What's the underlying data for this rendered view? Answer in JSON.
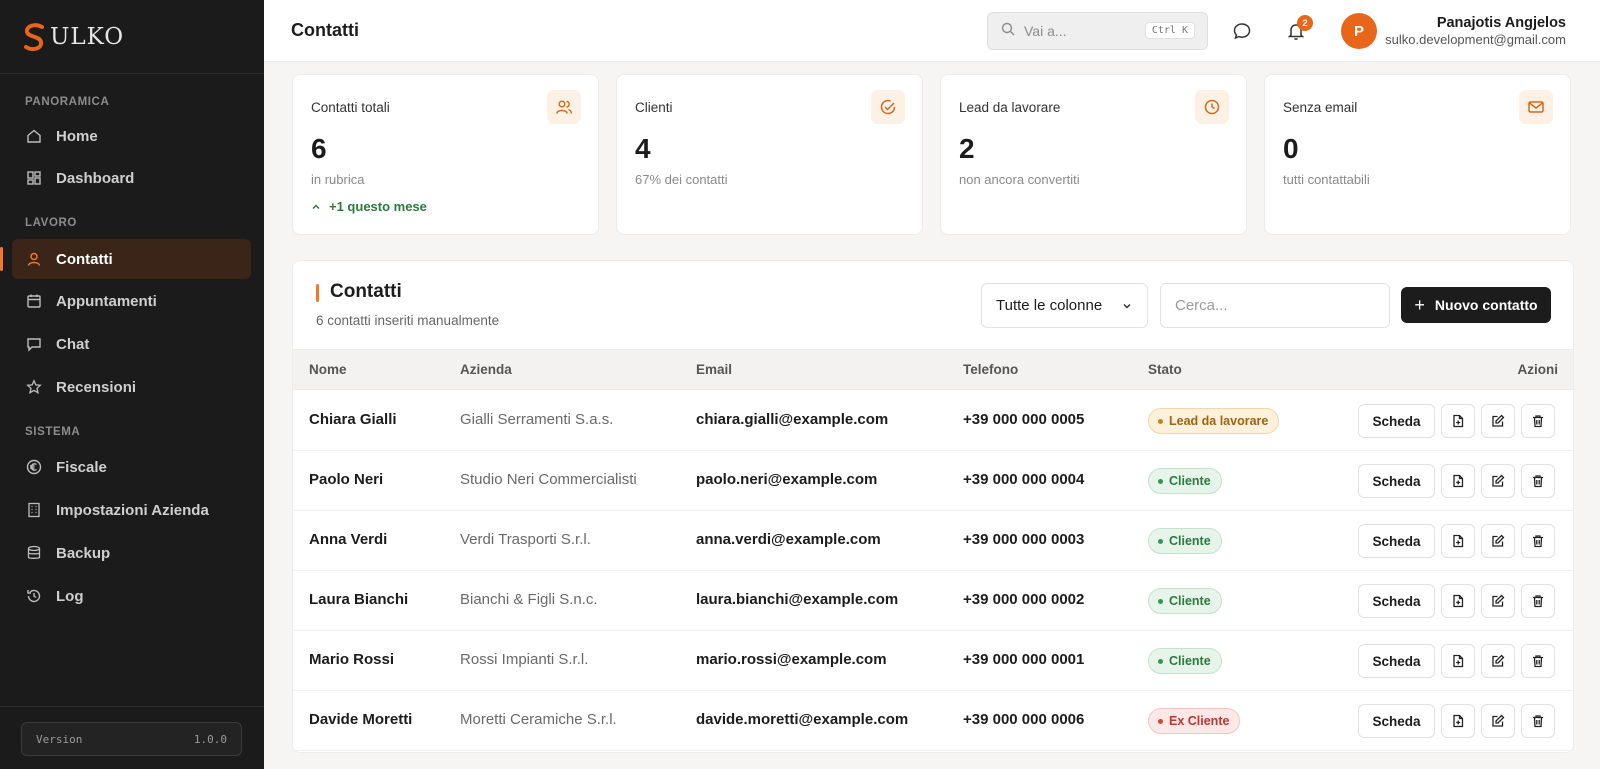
{
  "brand": {
    "name": "ULKO",
    "mark_letter": "S"
  },
  "sidebar": {
    "sections": [
      {
        "label": "PANORAMICA",
        "items": [
          {
            "label": "Home",
            "icon": "home-icon"
          },
          {
            "label": "Dashboard",
            "icon": "dashboard-icon"
          }
        ]
      },
      {
        "label": "LAVORO",
        "items": [
          {
            "label": "Contatti",
            "icon": "user-icon",
            "active": true
          },
          {
            "label": "Appuntamenti",
            "icon": "calendar-icon"
          },
          {
            "label": "Chat",
            "icon": "chat-icon"
          },
          {
            "label": "Recensioni",
            "icon": "star-icon"
          }
        ]
      },
      {
        "label": "SISTEMA",
        "items": [
          {
            "label": "Fiscale",
            "icon": "euro-icon"
          },
          {
            "label": "Impostazioni Azienda",
            "icon": "building-icon"
          },
          {
            "label": "Backup",
            "icon": "database-icon"
          },
          {
            "label": "Log",
            "icon": "history-icon"
          }
        ]
      }
    ],
    "version_label": "Version",
    "version_value": "1.0.0"
  },
  "header": {
    "title": "Contatti",
    "search_placeholder": "Vai a...",
    "search_shortcut": "Ctrl K",
    "notifications_count": "2",
    "user": {
      "initial": "P",
      "name": "Panajotis Angjelos",
      "email": "sulko.development@gmail.com"
    }
  },
  "stats": [
    {
      "label": "Contatti totali",
      "value": "6",
      "sub": "in rubrica",
      "trend": "+1 questo mese",
      "icon": "users-icon"
    },
    {
      "label": "Clienti",
      "value": "4",
      "sub": "67% dei contatti",
      "icon": "check-circle-icon"
    },
    {
      "label": "Lead da lavorare",
      "value": "2",
      "sub": "non ancora convertiti",
      "icon": "clock-icon"
    },
    {
      "label": "Senza email",
      "value": "0",
      "sub": "tutti contattabili",
      "icon": "mail-icon"
    }
  ],
  "contacts": {
    "title": "Contatti",
    "subtitle": "6 contatti inseriti manualmente",
    "column_filter": "Tutte le colonne",
    "search_placeholder": "Cerca...",
    "new_button": "Nuovo contatto",
    "columns": {
      "name": "Nome",
      "company": "Azienda",
      "email": "Email",
      "phone": "Telefono",
      "status": "Stato",
      "actions": "Azioni"
    },
    "action_label": "Scheda",
    "rows": [
      {
        "name": "Chiara Gialli",
        "company": "Gialli Serramenti S.a.s.",
        "email": "chiara.gialli@example.com",
        "phone": "+39 000 000 0005",
        "status": "Lead da lavorare",
        "status_type": "lead"
      },
      {
        "name": "Paolo Neri",
        "company": "Studio Neri Commercialisti",
        "email": "paolo.neri@example.com",
        "phone": "+39 000 000 0004",
        "status": "Cliente",
        "status_type": "cliente"
      },
      {
        "name": "Anna Verdi",
        "company": "Verdi Trasporti S.r.l.",
        "email": "anna.verdi@example.com",
        "phone": "+39 000 000 0003",
        "status": "Cliente",
        "status_type": "cliente"
      },
      {
        "name": "Laura Bianchi",
        "company": "Bianchi & Figli S.n.c.",
        "email": "laura.bianchi@example.com",
        "phone": "+39 000 000 0002",
        "status": "Cliente",
        "status_type": "cliente"
      },
      {
        "name": "Mario Rossi",
        "company": "Rossi Impianti S.r.l.",
        "email": "mario.rossi@example.com",
        "phone": "+39 000 000 0001",
        "status": "Cliente",
        "status_type": "cliente"
      },
      {
        "name": "Davide Moretti",
        "company": "Moretti Ceramiche S.r.l.",
        "email": "davide.moretti@example.com",
        "phone": "+39 000 000 0006",
        "status": "Ex Cliente",
        "status_type": "ex"
      }
    ]
  },
  "colors": {
    "accent": "#e8651a",
    "sidebar_bg": "#1b1b1b",
    "success": "#2b7a3e",
    "danger": "#c0362c"
  }
}
